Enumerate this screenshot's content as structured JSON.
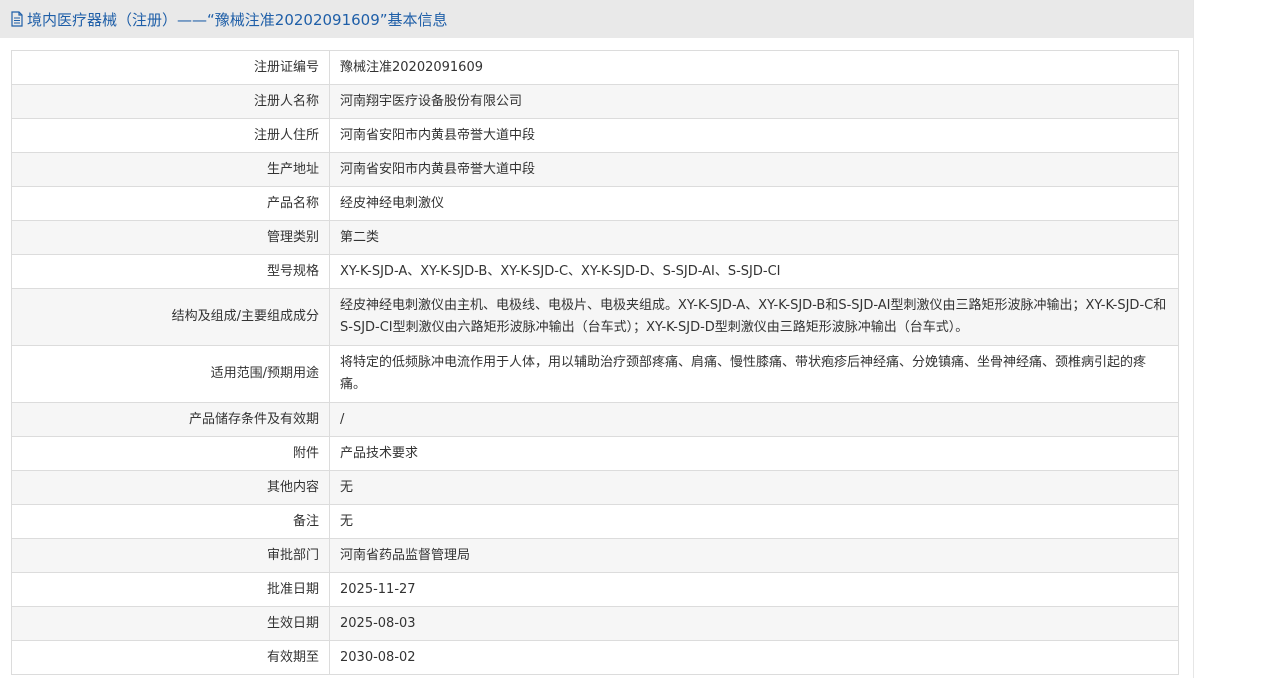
{
  "header": {
    "title": "境内医疗器械（注册）——“豫械注准20202091609”基本信息"
  },
  "rows": [
    {
      "label": "注册证编号",
      "value": "豫械注准20202091609"
    },
    {
      "label": "注册人名称",
      "value": "河南翔宇医疗设备股份有限公司"
    },
    {
      "label": "注册人住所",
      "value": "河南省安阳市内黄县帝誉大道中段"
    },
    {
      "label": "生产地址",
      "value": "河南省安阳市内黄县帝誉大道中段"
    },
    {
      "label": "产品名称",
      "value": "经皮神经电刺激仪"
    },
    {
      "label": "管理类别",
      "value": "第二类"
    },
    {
      "label": "型号规格",
      "value": "XY-K-SJD-A、XY-K-SJD-B、XY-K-SJD-C、XY-K-SJD-D、S-SJD-AI、S-SJD-CI"
    },
    {
      "label": "结构及组成/主要组成成分",
      "value": "经皮神经电刺激仪由主机、电极线、电极片、电极夹组成。XY-K-SJD-A、XY-K-SJD-B和S-SJD-AI型刺激仪由三路矩形波脉冲输出；XY-K-SJD-C和S-SJD-CI型刺激仪由六路矩形波脉冲输出（台车式）；XY-K-SJD-D型刺激仪由三路矩形波脉冲输出（台车式）。"
    },
    {
      "label": "适用范围/预期用途",
      "value": "将特定的低频脉冲电流作用于人体，用以辅助治疗颈部疼痛、肩痛、慢性膝痛、带状疱疹后神经痛、分娩镇痛、坐骨神经痛、颈椎病引起的疼痛。"
    },
    {
      "label": "产品储存条件及有效期",
      "value": "/"
    },
    {
      "label": "附件",
      "value": "产品技术要求"
    },
    {
      "label": "其他内容",
      "value": "无"
    },
    {
      "label": "备注",
      "value": "无"
    },
    {
      "label": "审批部门",
      "value": "河南省药品监督管理局"
    },
    {
      "label": "批准日期",
      "value": "2025-11-27"
    },
    {
      "label": "生效日期",
      "value": "2025-08-03"
    },
    {
      "label": "有效期至",
      "value": "2030-08-02"
    }
  ]
}
